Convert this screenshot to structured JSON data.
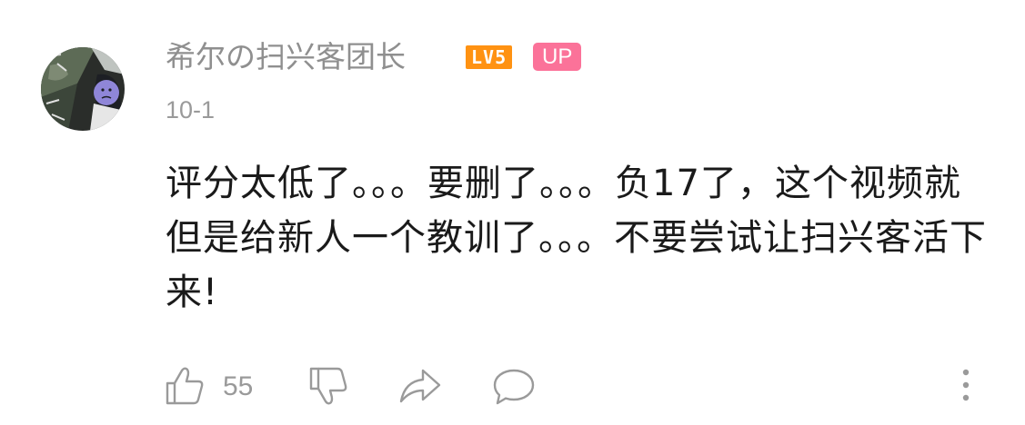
{
  "comment": {
    "username": "希尔の扫兴客团长",
    "level_badge": "LV5",
    "up_badge": "UP",
    "date": "10-1",
    "text": "评分太低了。。。要删了。。。负17了，这个视频就但是给新人一个教训了。。。不要尝试让扫兴客活下来!",
    "like_count": "55"
  },
  "colors": {
    "username": "#8f8f8f",
    "level_badge": "#ff9212",
    "up_badge": "#fb7299",
    "text": "#1a1a1a",
    "icon": "#9a9a9a"
  },
  "icons": {
    "like": "thumb-up-icon",
    "dislike": "thumb-down-icon",
    "share": "share-icon",
    "reply": "reply-icon",
    "more": "more-vertical-icon"
  }
}
